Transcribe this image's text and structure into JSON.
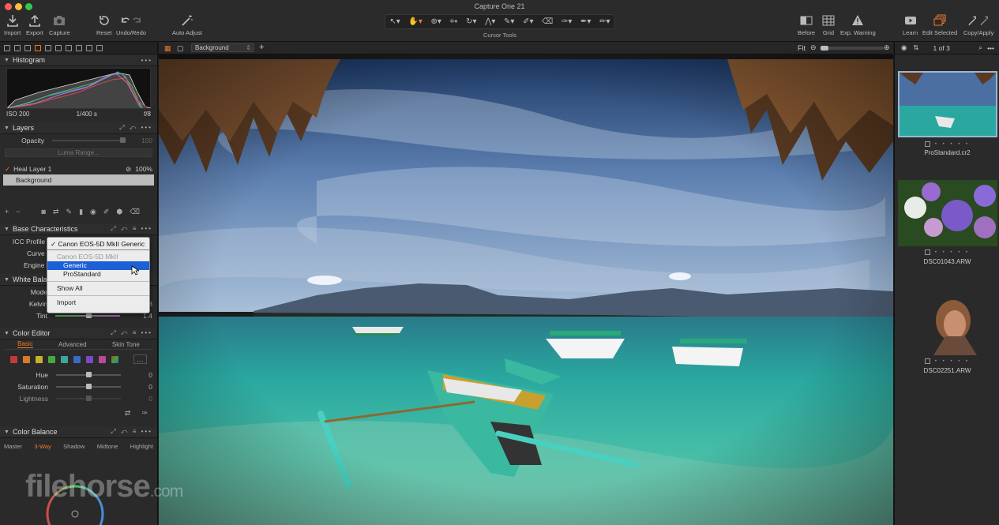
{
  "window": {
    "title": "Capture One 21"
  },
  "toolbar": {
    "import": "Import",
    "export": "Export",
    "capture": "Capture",
    "reset": "Reset",
    "undo_redo": "Undo/Redo",
    "auto_adjust": "Auto Adjust",
    "cursor_tools": "Cursor Tools",
    "before": "Before",
    "grid": "Grid",
    "exp_warning": "Exp. Warning",
    "learn": "Learn",
    "edit_selected": "Edit Selected",
    "copy_apply": "Copy/Apply"
  },
  "histogram": {
    "title": "Histogram",
    "iso": "ISO 200",
    "shutter": "1/400 s",
    "aperture": "f/8"
  },
  "layers": {
    "title": "Layers",
    "opacity_label": "Opacity",
    "opacity_value": "100",
    "luma_range": "Luma Range...",
    "items": [
      {
        "name": "Heal Layer 1",
        "opacity": "100%"
      },
      {
        "name": "Background"
      }
    ]
  },
  "base": {
    "title": "Base Characteristics",
    "icc_label": "ICC Profile",
    "curve_label": "Curve",
    "engine_label": "Engine",
    "icc_selected": "Canon EOS-5D MkII Generic",
    "dropdown": {
      "header": "Canon EOS-5D MkII",
      "options": [
        "Generic",
        "ProStandard"
      ],
      "highlighted": "Generic",
      "show_all": "Show All",
      "import": "Import"
    }
  },
  "white_balance": {
    "title": "White Bala",
    "mode_label": "Mode",
    "kelvin_label": "Kelvin",
    "kelvin_value": "5563",
    "tint_label": "Tint",
    "tint_value": "1.4"
  },
  "color_editor": {
    "title": "Color Editor",
    "tabs": [
      "Basic",
      "Advanced",
      "Skin Tone"
    ],
    "swatches": [
      "#c23a3a",
      "#d97a2a",
      "#c8b22a",
      "#4aa83a",
      "#3aa89a",
      "#3a6ac8",
      "#7a4ac8",
      "#b84a9a"
    ],
    "hue_label": "Hue",
    "hue_value": "0",
    "saturation_label": "Saturation",
    "saturation_value": "0",
    "lightness_label": "Lightness",
    "lightness_value": "0"
  },
  "color_balance": {
    "title": "Color Balance",
    "tabs": [
      "Master",
      "3-Way",
      "Shadow",
      "Midtone",
      "Highlight"
    ]
  },
  "viewer": {
    "layer_select": "Background",
    "zoom": "Fit"
  },
  "browser": {
    "counter": "1 of 3",
    "items": [
      {
        "name": "ProStandard.cr2"
      },
      {
        "name": "DSC01043.ARW"
      },
      {
        "name": "DSC02251.ARW"
      }
    ]
  },
  "watermark": {
    "brand": "filehorse",
    "tld": ".com"
  },
  "colors": {
    "accent": "#f07a2a",
    "highlight": "#1d5fd6"
  }
}
